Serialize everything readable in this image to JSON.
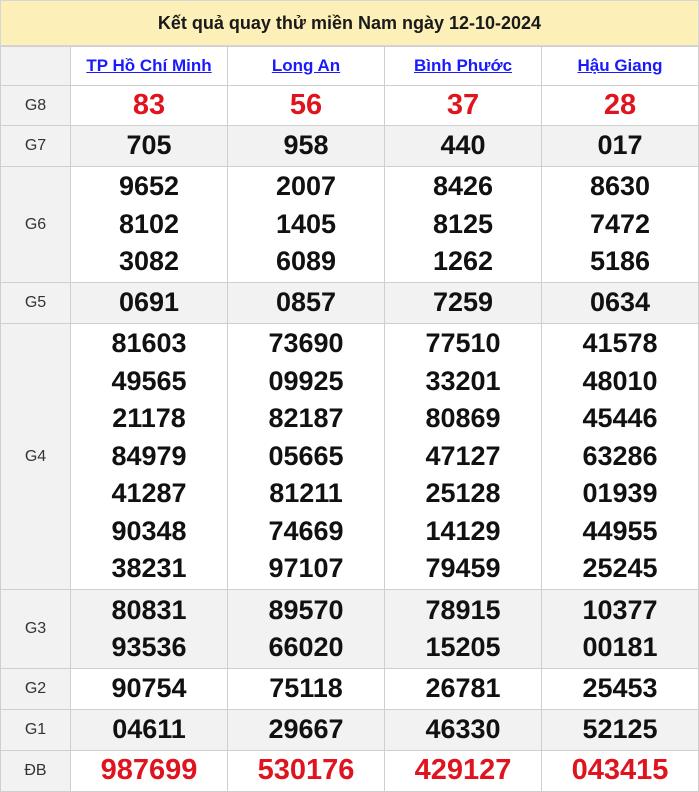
{
  "title": "Kết quả quay thử miền Nam ngày 12-10-2024",
  "provinces": [
    "TP Hồ Chí Minh",
    "Long An",
    "Bình Phước",
    "Hậu Giang"
  ],
  "prizes": [
    {
      "label": "G8",
      "values": [
        [
          "83"
        ],
        [
          "56"
        ],
        [
          "37"
        ],
        [
          "28"
        ]
      ],
      "highlight": true
    },
    {
      "label": "G7",
      "values": [
        [
          "705"
        ],
        [
          "958"
        ],
        [
          "440"
        ],
        [
          "017"
        ]
      ]
    },
    {
      "label": "G6",
      "values": [
        [
          "9652",
          "8102",
          "3082"
        ],
        [
          "2007",
          "1405",
          "6089"
        ],
        [
          "8426",
          "8125",
          "1262"
        ],
        [
          "8630",
          "7472",
          "5186"
        ]
      ]
    },
    {
      "label": "G5",
      "values": [
        [
          "0691"
        ],
        [
          "0857"
        ],
        [
          "7259"
        ],
        [
          "0634"
        ]
      ]
    },
    {
      "label": "G4",
      "values": [
        [
          "81603",
          "49565",
          "21178",
          "84979",
          "41287",
          "90348",
          "38231"
        ],
        [
          "73690",
          "09925",
          "82187",
          "05665",
          "81211",
          "74669",
          "97107"
        ],
        [
          "77510",
          "33201",
          "80869",
          "47127",
          "25128",
          "14129",
          "79459"
        ],
        [
          "41578",
          "48010",
          "45446",
          "63286",
          "01939",
          "44955",
          "25245"
        ]
      ]
    },
    {
      "label": "G3",
      "values": [
        [
          "80831",
          "93536"
        ],
        [
          "89570",
          "66020"
        ],
        [
          "78915",
          "15205"
        ],
        [
          "10377",
          "00181"
        ]
      ]
    },
    {
      "label": "G2",
      "values": [
        [
          "90754"
        ],
        [
          "75118"
        ],
        [
          "26781"
        ],
        [
          "25453"
        ]
      ]
    },
    {
      "label": "G1",
      "values": [
        [
          "04611"
        ],
        [
          "29667"
        ],
        [
          "46330"
        ],
        [
          "52125"
        ]
      ]
    },
    {
      "label": "ĐB",
      "values": [
        [
          "987699"
        ],
        [
          "530176"
        ],
        [
          "429127"
        ],
        [
          "043415"
        ]
      ],
      "highlight": true
    }
  ]
}
